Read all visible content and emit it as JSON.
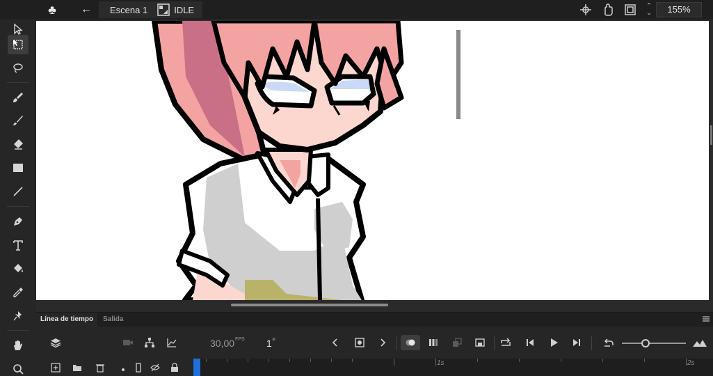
{
  "topbar": {
    "scene_label": "Escena 1",
    "symbol_label": "IDLE",
    "zoom_value": "155%",
    "icons": [
      "club-icon",
      "back-arrow-icon",
      "movie-clip-icon",
      "center-stage-icon",
      "rotate-hand-icon",
      "clip-stage-icon"
    ]
  },
  "toolbar": {
    "tools": [
      "select-arrow-icon",
      "free-transform-icon",
      "lasso-icon",
      "paint-brush-icon",
      "brush-icon",
      "eraser-icon",
      "rectangle-icon",
      "line-icon",
      "pen-icon",
      "text-icon",
      "paint-bucket-icon",
      "eyedropper-icon",
      "pin-icon",
      "hand-icon",
      "zoom-icon"
    ],
    "active_tool": "free-transform-icon"
  },
  "timeline": {
    "tab_timeline": "Línea de tiempo",
    "tab_output": "Salida",
    "fps_value": "30,00",
    "fps_unit": "FPS",
    "frame_value": "1",
    "frame_unit": "F",
    "ruler_labels": [
      "1s",
      "2s"
    ]
  },
  "colors": {
    "accent": "#1e6fd9",
    "hair": "#f4a3a3",
    "hair_shadow": "#c96f86",
    "skin": "#fbd7cf",
    "shirt": "#ffffff",
    "shirt_shadow": "#cfcfcf",
    "eyes": "#c9d9f6"
  }
}
